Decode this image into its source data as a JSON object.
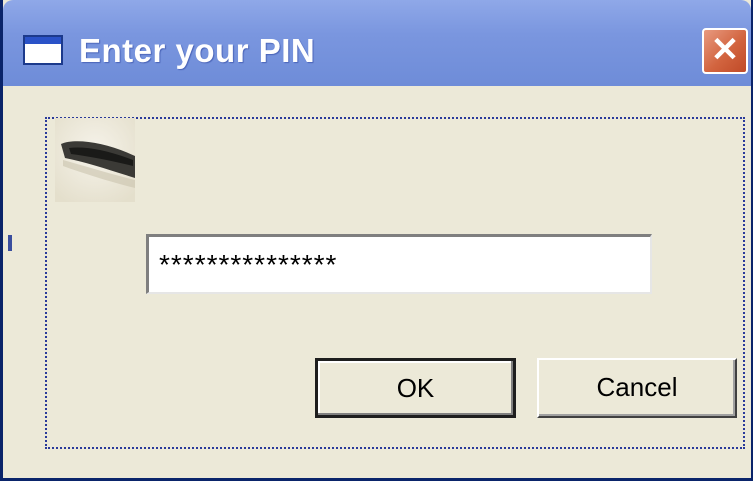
{
  "window": {
    "title": "Enter your PIN",
    "close_symbol": "✕",
    "icon": "window-icon"
  },
  "form": {
    "image_icon": "security-lock-image",
    "pin_value": "***************"
  },
  "buttons": {
    "ok_label": "OK",
    "cancel_label": "Cancel"
  },
  "colors": {
    "titlebar": "#7A96DF",
    "dialog_background": "#ECE9D8",
    "close_button": "#D2643F",
    "focus_border": "#2A3A9A"
  }
}
